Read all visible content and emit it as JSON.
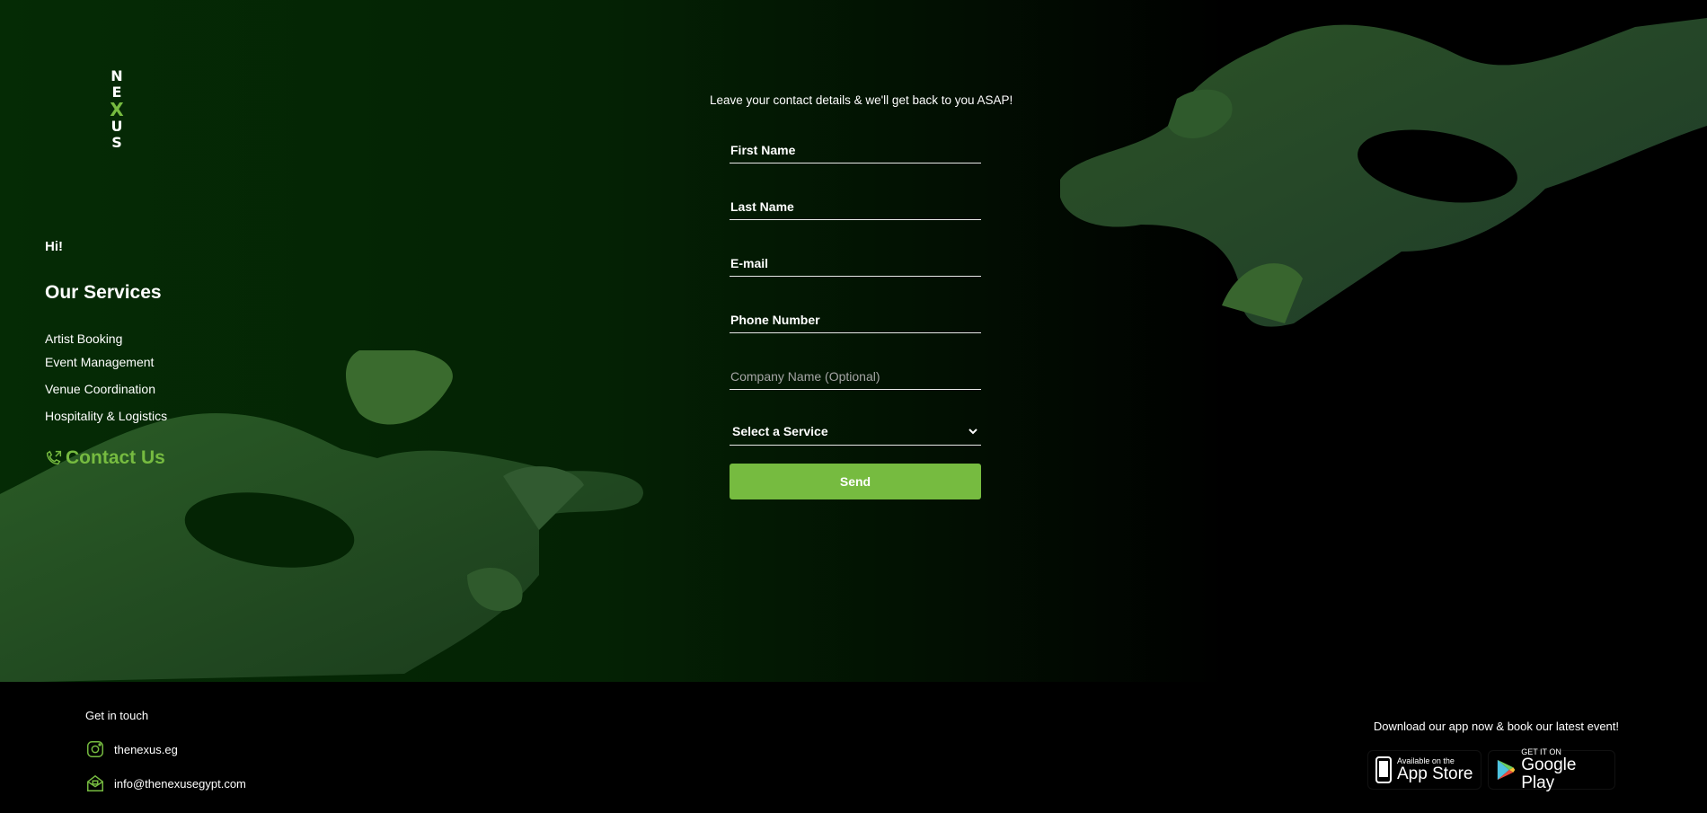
{
  "brand": {
    "logo_letters": [
      "N",
      "E",
      "X",
      "U",
      "S"
    ],
    "accent_color": "#76bb40"
  },
  "sidebar": {
    "greeting": "Hi!",
    "services_title": "Our Services",
    "services": [
      "Artist Booking",
      "Event Management",
      "Venue Coordination",
      "Hospitality & Logistics"
    ],
    "contact_label": "Contact Us",
    "contact_icon": "phone-contact-icon"
  },
  "form": {
    "intro": "Leave your contact details & we'll get back to you ASAP!",
    "first_name_placeholder": "First Name",
    "last_name_placeholder": "Last Name",
    "email_placeholder": "E-mail",
    "phone_placeholder": "Phone Number",
    "company_placeholder": "Company Name (Optional)",
    "service_select_label": "Select a Service",
    "send_label": "Send"
  },
  "footer": {
    "get_in_touch": "Get in touch",
    "instagram_handle": "thenexus.eg",
    "instagram_icon": "instagram-icon",
    "email": "info@thenexusegypt.com",
    "email_icon": "mail-icon",
    "download_text": "Download our app now & book our latest event!",
    "app_store": {
      "small": "Available on the",
      "big": "App Store"
    },
    "google_play": {
      "small": "GET IT ON",
      "big": "Google Play"
    }
  }
}
